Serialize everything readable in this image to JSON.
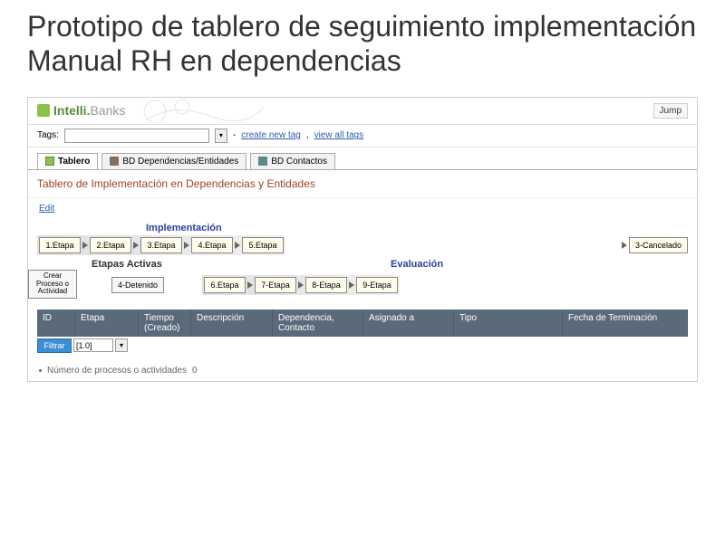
{
  "slide_title": "Prototipo de tablero de seguimiento implementación Manual RH en dependencias",
  "logo": {
    "part1": "Intelli.",
    "part2": "Banks"
  },
  "jump_label": "Jump",
  "tags": {
    "label": "Tags:",
    "create": "create new tag",
    "view": "view all tags"
  },
  "tabs": [
    {
      "label": "Tablero",
      "active": true
    },
    {
      "label": "BD Dependencias/Entidades",
      "active": false
    },
    {
      "label": "BD Contactos",
      "active": false
    }
  ],
  "page_title": "Tablero de Implementación en Dependencias y Entidades",
  "edit": "Edit",
  "sections": {
    "impl": "Implementación",
    "eval": "Evaluación",
    "activas": "Etapas Activas"
  },
  "stages_impl": [
    "1.Etapa",
    "2.Etapa",
    "3.Etapa",
    "4.Etapa",
    "5.Etapa"
  ],
  "stage_canc": "3-Cancelado",
  "crear": "Crear Proceso o Actividad",
  "stage_det": "4-Detenido",
  "stages_eval": [
    "6.Etapa",
    "7-Etapa",
    "8-Etapa",
    "9-Etapa"
  ],
  "columns": {
    "id": "ID",
    "etapa": "Etapa",
    "tiempo": "Tiempo (Creado)",
    "desc": "Descripción",
    "dep": "Dependencia, Contacto",
    "asig": "Asignado a",
    "tipo": "Tipo",
    "fecha": "Fecha de Terminación"
  },
  "filter": {
    "btn": "Filtrar",
    "val": "[1.0]"
  },
  "footer": {
    "label": "Número de procesos o actividades",
    "count": "0"
  }
}
